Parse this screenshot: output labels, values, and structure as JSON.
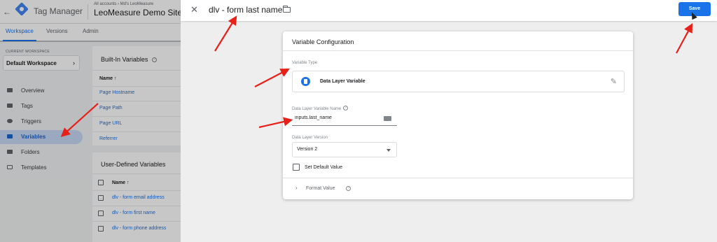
{
  "header": {
    "product_name": "Tag Manager",
    "accounts_crumb": "All accounts › Md's LeoMeasure",
    "container_name": "LeoMeasure Demo Site"
  },
  "tabs": [
    {
      "label": "Workspace"
    },
    {
      "label": "Versions"
    },
    {
      "label": "Admin"
    }
  ],
  "sidebar": {
    "current_workspace_label": "CURRENT WORKSPACE",
    "workspace_name": "Default Workspace",
    "items": [
      {
        "label": "Overview",
        "icon": "overview-icon"
      },
      {
        "label": "Tags",
        "icon": "tag-icon"
      },
      {
        "label": "Triggers",
        "icon": "trigger-icon"
      },
      {
        "label": "Variables",
        "icon": "variable-icon"
      },
      {
        "label": "Folders",
        "icon": "folder-icon"
      },
      {
        "label": "Templates",
        "icon": "template-icon"
      }
    ]
  },
  "builtin": {
    "title": "Built-In Variables",
    "col_name": "Name ↑",
    "rows": [
      "Page Hostname",
      "Page Path",
      "Page URL",
      "Referrer"
    ]
  },
  "userdef": {
    "title": "User-Defined Variables",
    "col_name": "Name ↑",
    "rows": [
      "dlv - form email address",
      "dlv - form first name",
      "dlv - form phone address"
    ]
  },
  "panel": {
    "title": "dlv - form last name",
    "save_label": "Save",
    "config_title": "Variable Configuration",
    "type_label": "Variable Type",
    "type_name": "Data Layer Variable",
    "name_label": "Data Layer Variable Name",
    "name_value": "inputs.last_name",
    "version_label": "Data Layer Version",
    "version_value": "Version 2",
    "default_value_label": "Set Default Value",
    "format_value_label": "Format Value"
  },
  "colors": {
    "accent": "#1a73e8",
    "annotation_arrow": "#e8201a"
  }
}
